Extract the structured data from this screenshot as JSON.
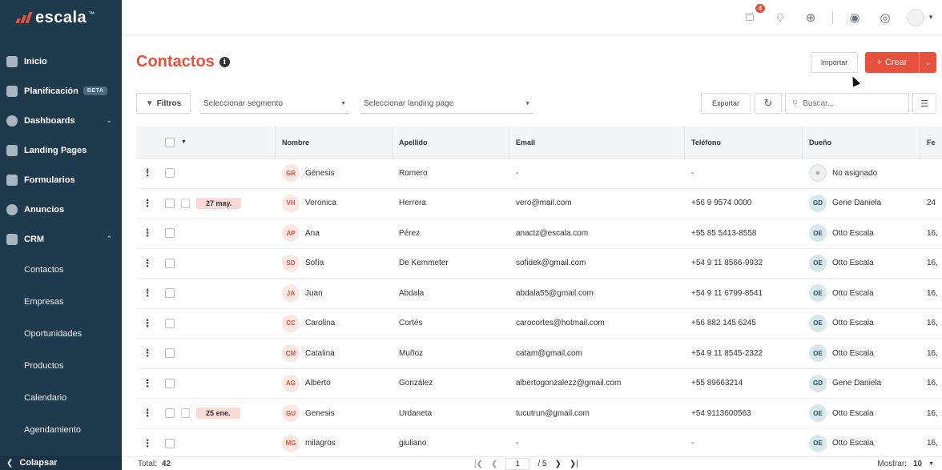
{
  "brand": {
    "name": "escala",
    "trademark": "™",
    "accent": "#e8513d",
    "sidebar_bg": "#1f3a4d"
  },
  "sidebar": {
    "items": [
      {
        "label": "Inicio",
        "icon": "home-icon"
      },
      {
        "label": "Planificación",
        "icon": "filter-icon",
        "badge": "BETA"
      },
      {
        "label": "Dashboards",
        "icon": "pie-chart-icon",
        "expand": "collapsed"
      },
      {
        "label": "Landing Pages",
        "icon": "landing-page-icon"
      },
      {
        "label": "Formularios",
        "icon": "form-icon"
      },
      {
        "label": "Anuncios",
        "icon": "ads-icon"
      },
      {
        "label": "CRM",
        "icon": "people-icon",
        "expand": "expanded"
      }
    ],
    "crm_sub": [
      "Contactos",
      "Empresas",
      "Oportunidades",
      "Productos",
      "Calendario",
      "Agendamiento"
    ],
    "collapse_label": "Colapsar"
  },
  "topbar": {
    "chat_badge": "4"
  },
  "header": {
    "title": "Contactos",
    "import_label": "Importar",
    "create_label": "Crear"
  },
  "filters": {
    "filtros_label": "Filtros",
    "segment_placeholder": "Seleccionar segmento",
    "landing_placeholder": "Seleccionar landing page",
    "export_label": "Exportar",
    "search_placeholder": "Buscar..."
  },
  "table": {
    "columns": [
      "Nombre",
      "Apellido",
      "Email",
      "Teléfono",
      "Dueño",
      "Fe"
    ],
    "rows": [
      {
        "initials": "GR",
        "date": "",
        "nombre": "Génesis",
        "apellido": "Romero",
        "email": "-",
        "telefono": "-",
        "owner_initials": "",
        "owner": "No asignado",
        "fecha": ""
      },
      {
        "initials": "VH",
        "date": "27 may.",
        "nombre": "Veronica",
        "apellido": "Herrera",
        "email": "vero@mail.com",
        "telefono": "+56 9 9574 0000",
        "owner_initials": "GD",
        "owner": "Gene Daniela",
        "fecha": "24"
      },
      {
        "initials": "AP",
        "date": "",
        "nombre": "Ana",
        "apellido": "Pérez",
        "email": "anactz@escala.com",
        "telefono": "+55 85 5413-8558",
        "owner_initials": "OE",
        "owner": "Otto Escala",
        "fecha": "16,"
      },
      {
        "initials": "SD",
        "date": "",
        "nombre": "Sofía",
        "apellido": "De Kemmeter",
        "email": "sofidek@gmail.com",
        "telefono": "+54 9 11 8566-9932",
        "owner_initials": "OE",
        "owner": "Otto Escala",
        "fecha": "16,"
      },
      {
        "initials": "JA",
        "date": "",
        "nombre": "Juan",
        "apellido": "Abdala",
        "email": "abdala55@gmail.com",
        "telefono": "+54 9 11 6799-8541",
        "owner_initials": "OE",
        "owner": "Otto Escala",
        "fecha": "16,"
      },
      {
        "initials": "CC",
        "date": "",
        "nombre": "Carolina",
        "apellido": "Cortés",
        "email": "carocortes@hotmail.com",
        "telefono": "+56 882 145 6245",
        "owner_initials": "OE",
        "owner": "Otto Escala",
        "fecha": "16,"
      },
      {
        "initials": "CM",
        "date": "",
        "nombre": "Catalina",
        "apellido": "Muñoz",
        "email": "catam@gmail.com",
        "telefono": "+54 9 11 8545-2322",
        "owner_initials": "OE",
        "owner": "Otto Escala",
        "fecha": "16,"
      },
      {
        "initials": "AG",
        "date": "",
        "nombre": "Alberto",
        "apellido": "González",
        "email": "albertogonzalezz@gmail.com",
        "telefono": "+55 89663214",
        "owner_initials": "GD",
        "owner": "Gene Daniela",
        "fecha": "16,"
      },
      {
        "initials": "GU",
        "date": "25 ene.",
        "nombre": "Genesis",
        "apellido": "Urdaneta",
        "email": "tucutrun@gmail.com",
        "telefono": "+54 9113600563",
        "owner_initials": "OE",
        "owner": "Otto Escala",
        "fecha": "16,"
      },
      {
        "initials": "MG",
        "date": "",
        "nombre": "milagros",
        "apellido": "giuliano",
        "email": "-",
        "telefono": "-",
        "owner_initials": "OE",
        "owner": "Otto Escala",
        "fecha": "16,"
      }
    ]
  },
  "footer": {
    "total_label": "Total:",
    "total": "42",
    "page": "1",
    "of_label": "/ 5",
    "show_label": "Mostrar:",
    "show_value": "10"
  }
}
